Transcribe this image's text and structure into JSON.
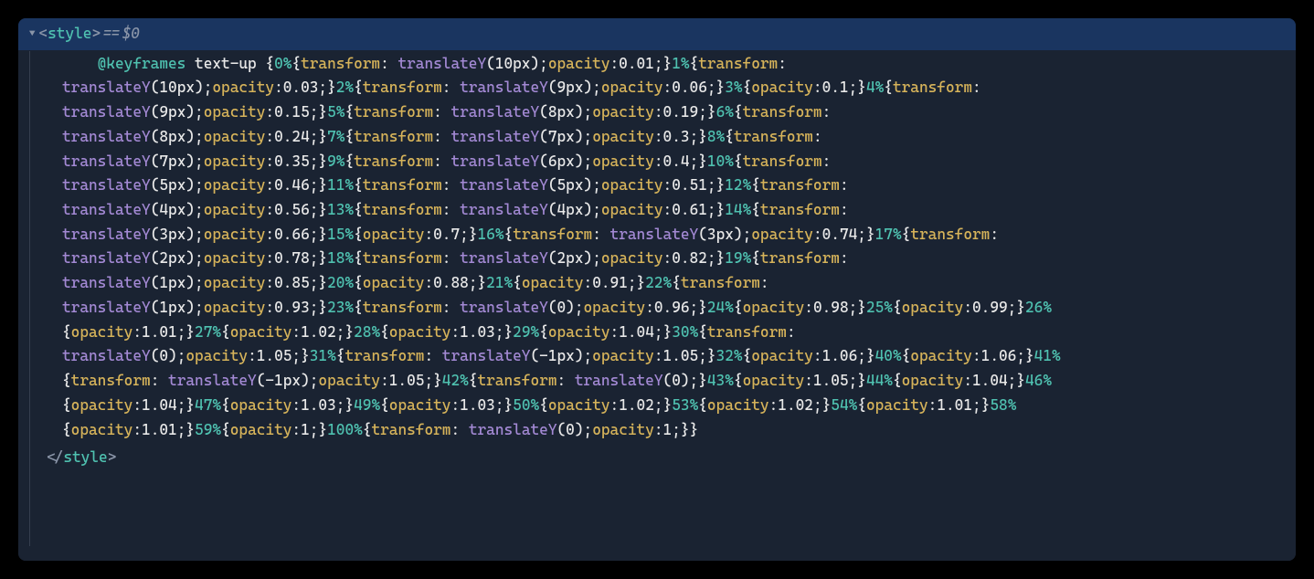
{
  "header": {
    "open_tag_name": "style",
    "eq_marker": " == ",
    "dollar_marker": "$0"
  },
  "at_rule": "@keyframes",
  "animation_name": "text-up",
  "keyframes": [
    {
      "pct": "0%",
      "transform": "10px",
      "opacity": "0.01"
    },
    {
      "pct": "1%",
      "transform": "10px",
      "opacity": "0.03"
    },
    {
      "pct": "2%",
      "transform": "9px",
      "opacity": "0.06"
    },
    {
      "pct": "3%",
      "transform": null,
      "opacity": "0.1"
    },
    {
      "pct": "4%",
      "transform": "9px",
      "opacity": "0.15"
    },
    {
      "pct": "5%",
      "transform": "8px",
      "opacity": "0.19"
    },
    {
      "pct": "6%",
      "transform": "8px",
      "opacity": "0.24"
    },
    {
      "pct": "7%",
      "transform": "7px",
      "opacity": "0.3"
    },
    {
      "pct": "8%",
      "transform": "7px",
      "opacity": "0.35"
    },
    {
      "pct": "9%",
      "transform": "6px",
      "opacity": "0.4"
    },
    {
      "pct": "10%",
      "transform": "5px",
      "opacity": "0.46"
    },
    {
      "pct": "11%",
      "transform": "5px",
      "opacity": "0.51"
    },
    {
      "pct": "12%",
      "transform": "4px",
      "opacity": "0.56"
    },
    {
      "pct": "13%",
      "transform": "4px",
      "opacity": "0.61"
    },
    {
      "pct": "14%",
      "transform": "3px",
      "opacity": "0.66"
    },
    {
      "pct": "15%",
      "transform": null,
      "opacity": "0.7"
    },
    {
      "pct": "16%",
      "transform": "3px",
      "opacity": "0.74"
    },
    {
      "pct": "17%",
      "transform": "2px",
      "opacity": "0.78"
    },
    {
      "pct": "18%",
      "transform": "2px",
      "opacity": "0.82"
    },
    {
      "pct": "19%",
      "transform": "1px",
      "opacity": "0.85"
    },
    {
      "pct": "20%",
      "transform": null,
      "opacity": "0.88"
    },
    {
      "pct": "21%",
      "transform": null,
      "opacity": "0.91"
    },
    {
      "pct": "22%",
      "transform": "1px",
      "opacity": "0.93"
    },
    {
      "pct": "23%",
      "transform": "0",
      "opacity": "0.96"
    },
    {
      "pct": "24%",
      "transform": null,
      "opacity": "0.98"
    },
    {
      "pct": "25%",
      "transform": null,
      "opacity": "0.99"
    },
    {
      "pct": "26%",
      "transform": null,
      "opacity": "1.01"
    },
    {
      "pct": "27%",
      "transform": null,
      "opacity": "1.02"
    },
    {
      "pct": "28%",
      "transform": null,
      "opacity": "1.03"
    },
    {
      "pct": "29%",
      "transform": null,
      "opacity": "1.04"
    },
    {
      "pct": "30%",
      "transform": "0",
      "opacity": "1.05"
    },
    {
      "pct": "31%",
      "transform": "-1px",
      "opacity": "1.05"
    },
    {
      "pct": "32%",
      "transform": null,
      "opacity": "1.06"
    },
    {
      "pct": "40%",
      "transform": null,
      "opacity": "1.06"
    },
    {
      "pct": "41%",
      "transform": "-1px",
      "opacity": "1.05"
    },
    {
      "pct": "42%",
      "transform": "0",
      "opacity": null
    },
    {
      "pct": "43%",
      "transform": null,
      "opacity": "1.05"
    },
    {
      "pct": "44%",
      "transform": null,
      "opacity": "1.04"
    },
    {
      "pct": "46%",
      "transform": null,
      "opacity": "1.04"
    },
    {
      "pct": "47%",
      "transform": null,
      "opacity": "1.03"
    },
    {
      "pct": "49%",
      "transform": null,
      "opacity": "1.03"
    },
    {
      "pct": "50%",
      "transform": null,
      "opacity": "1.02"
    },
    {
      "pct": "53%",
      "transform": null,
      "opacity": "1.02"
    },
    {
      "pct": "54%",
      "transform": null,
      "opacity": "1.01"
    },
    {
      "pct": "58%",
      "transform": null,
      "opacity": "1.01"
    },
    {
      "pct": "59%",
      "transform": null,
      "opacity": "1"
    },
    {
      "pct": "100%",
      "transform": "0",
      "opacity": "1"
    }
  ],
  "closing_tag_name": "style",
  "tokens": {
    "transform": "transform",
    "translateY": "translateY",
    "opacity": "opacity"
  }
}
